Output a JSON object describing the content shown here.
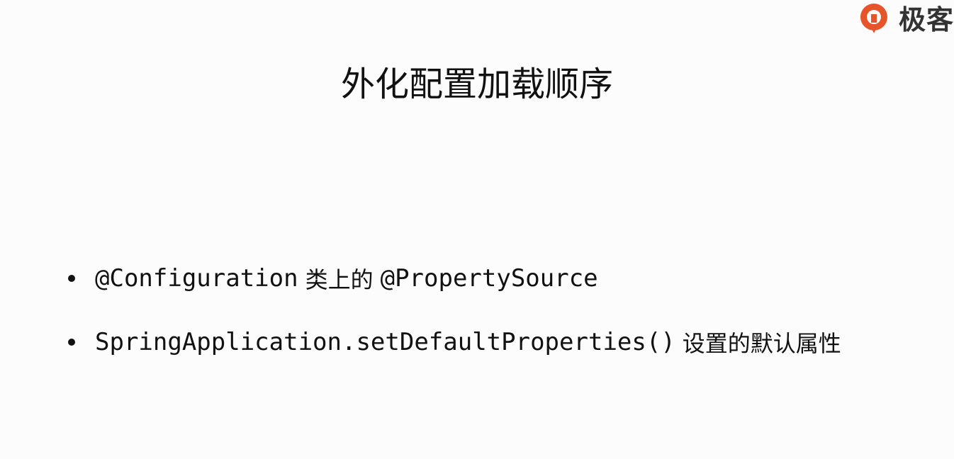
{
  "logo": {
    "text": "极客",
    "icon": "geekbang-logo-icon",
    "brand_color": "#e8542a"
  },
  "slide": {
    "title": "外化配置加载顺序",
    "bullets": [
      {
        "code_before": "@Configuration",
        "text": "类上的",
        "code_after": "@PropertySource"
      },
      {
        "code_before": "SpringApplication.setDefaultProperties()",
        "text": "设置的默认属性",
        "code_after": ""
      }
    ]
  }
}
